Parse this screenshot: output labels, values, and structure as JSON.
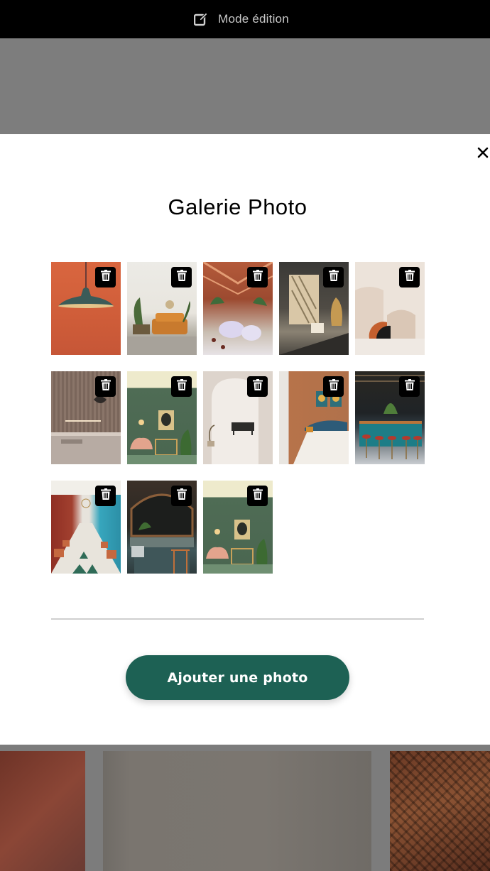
{
  "topbar": {
    "icon": "edit-icon",
    "label": "Mode édition"
  },
  "modal": {
    "title": "Galerie Photo",
    "close_icon": "close-icon",
    "delete_icon": "trash-icon",
    "add_button_label": "Ajouter une photo",
    "accent_color": "#1d6154"
  },
  "gallery": [
    {
      "subject": "abajour-pendant-lamp"
    },
    {
      "subject": "living-room-plants"
    },
    {
      "subject": "glass-roof-restaurant"
    },
    {
      "subject": "sunny-room-rattan-chair"
    },
    {
      "subject": "arch-shapes-beige"
    },
    {
      "subject": "wood-kitchen-shelf"
    },
    {
      "subject": "green-wall-armchair"
    },
    {
      "subject": "white-arch-room"
    },
    {
      "subject": "bedroom-teal-headboard"
    },
    {
      "subject": "teal-bar-stools"
    },
    {
      "subject": "long-restaurant-red-walls"
    },
    {
      "subject": "dark-bar-counter"
    },
    {
      "subject": "green-wall-armchair-2"
    }
  ]
}
